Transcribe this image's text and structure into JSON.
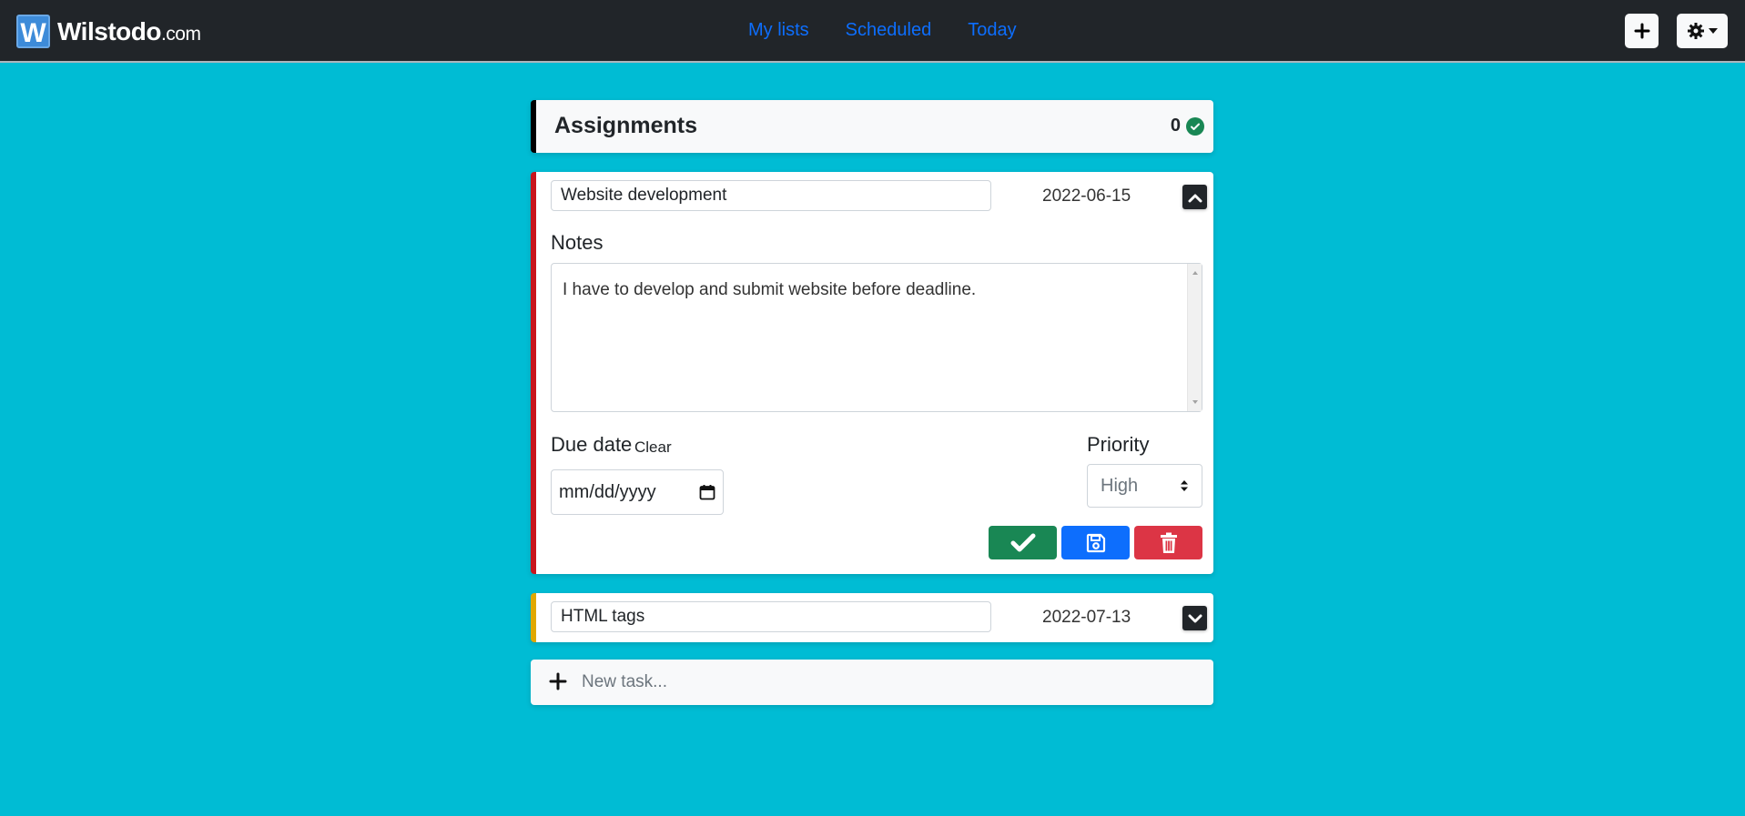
{
  "brand": {
    "logo_letter": "W",
    "name": "Wilstodo",
    "domain": ".com"
  },
  "nav": {
    "items": [
      {
        "label": "My lists"
      },
      {
        "label": "Scheduled"
      },
      {
        "label": "Today"
      }
    ]
  },
  "list": {
    "title": "Assignments",
    "completed_count": "0"
  },
  "tasks": [
    {
      "name": "Website development",
      "date": "2022-06-15",
      "expanded": true,
      "priority_color": "#c8161d",
      "notes_label": "Notes",
      "notes": "I have to develop and submit website before deadline.",
      "due_label": "Due date",
      "clear_label": "Clear",
      "due_placeholder": "mm/dd/yyyy",
      "priority_label": "Priority",
      "priority_value": "High"
    },
    {
      "name": "HTML tags",
      "date": "2022-07-13",
      "expanded": false,
      "priority_color": "#e0a800"
    }
  ],
  "new_task": {
    "placeholder": "New task..."
  },
  "colors": {
    "background": "#00bcd4",
    "navbar": "#212529",
    "link": "#0d6efd",
    "done": "#198754",
    "save": "#0d6efd",
    "delete": "#dc3545"
  },
  "icons": {
    "add": "plus-icon",
    "settings": "gear-icon",
    "collapse": "chevron-up-icon",
    "expand": "chevron-down-icon",
    "done": "check-icon",
    "save": "floppy-disk-icon",
    "delete": "trash-icon",
    "calendar": "calendar-icon",
    "count": "check-circle-icon"
  }
}
